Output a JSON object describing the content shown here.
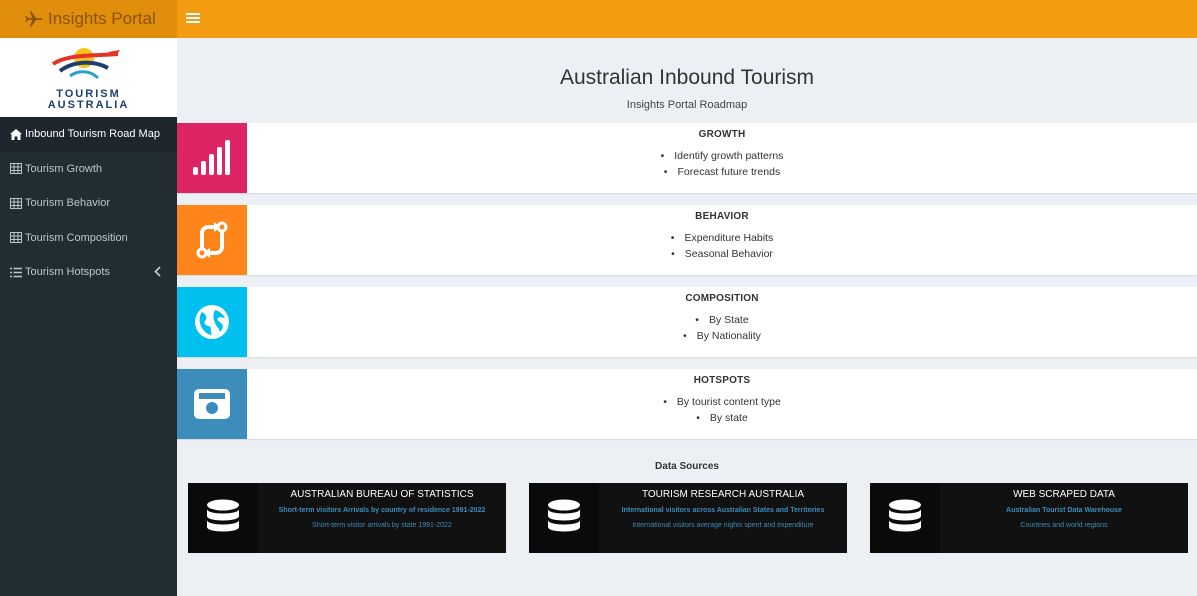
{
  "header": {
    "brand": "Insights Portal",
    "brand_icon": "plane-icon",
    "colors": {
      "bar": "#f39c12",
      "brand_bg": "#e08e0b"
    }
  },
  "sidebar": {
    "logo_line1": "TOURISM",
    "logo_line2": "AUSTRALIA",
    "items": [
      {
        "label": "Inbound Tourism Road Map",
        "icon": "home-icon",
        "active": true
      },
      {
        "label": "Tourism Growth",
        "icon": "table-icon"
      },
      {
        "label": "Tourism Behavior",
        "icon": "table-icon"
      },
      {
        "label": "Tourism Composition",
        "icon": "table-icon"
      },
      {
        "label": "Tourism Hotspots",
        "icon": "list-icon",
        "chevron": "chevron-left-icon"
      }
    ]
  },
  "main": {
    "title": "Australian Inbound Tourism",
    "subtitle": "Insights Portal Roadmap",
    "cards": [
      {
        "title": "GROWTH",
        "icon": "signal-bars-icon",
        "color": "#dd2566",
        "items": [
          "Identify growth patterns",
          "Forecast future trends"
        ]
      },
      {
        "title": "BEHAVIOR",
        "icon": "exchange-icon",
        "color": "#ff851b",
        "items": [
          "Expenditure Habits",
          "Seasonal Behavior"
        ]
      },
      {
        "title": "COMPOSITION",
        "icon": "globe-icon",
        "color": "#00c0ef",
        "items": [
          "By State",
          "By Nationality"
        ]
      },
      {
        "title": "HOTSPOTS",
        "icon": "camera-icon",
        "color": "#3c8dbc",
        "items": [
          "By tourist content type",
          "By state"
        ]
      }
    ],
    "data_sources_title": "Data Sources",
    "data_sources": [
      {
        "name": "AUSTRALIAN BUREAU OF STATISTICS",
        "line1": "Short-term visitors Arrivals by country of residence 1991-2022",
        "line2": "Short-term visitor arrivals by state 1991-2022",
        "icon": "database-icon"
      },
      {
        "name": "TOURISM RESEARCH AUSTRALIA",
        "line1": "International visitors across Australian States and Territories",
        "line2": "International visitors average nights spent and expenditure",
        "icon": "database-icon"
      },
      {
        "name": "WEB SCRAPED DATA",
        "line1": "Australian Tourist Data Warehouse",
        "line2": "Countries and world regions",
        "icon": "database-icon"
      }
    ]
  }
}
